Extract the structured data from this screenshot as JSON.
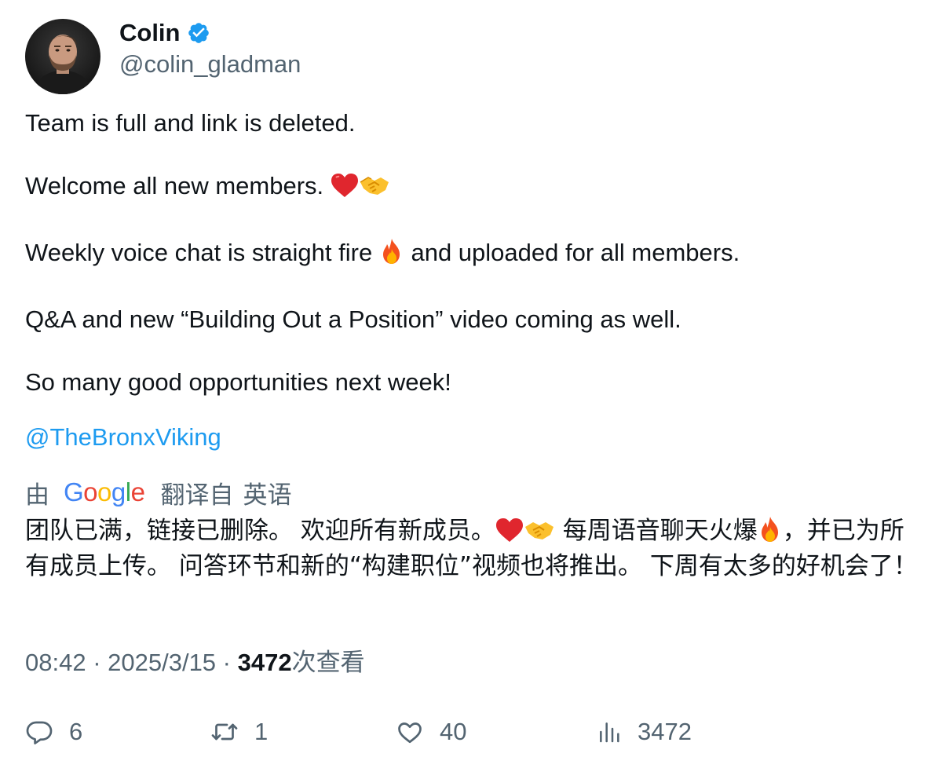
{
  "author": {
    "display_name": "Colin",
    "handle": "@colin_gladman",
    "verified": true,
    "avatar_icon": "avatar-photo"
  },
  "tweet": {
    "line1": "Team is full and link is deleted.",
    "line2_text": "Welcome all new members.",
    "line2_emoji": [
      "red-heart",
      "handshake"
    ],
    "line3_before": "Weekly voice chat is straight fire",
    "line3_emoji": "fire",
    "line3_after": "and uploaded for all members.",
    "line4": "Q&A and new “Building Out a Position” video coming as well.",
    "line5": "So many good opportunities next week!",
    "mention": "@TheBronxViking"
  },
  "translation": {
    "prefix": "由",
    "provider": "Google",
    "suffix": "翻译自",
    "language": "英语",
    "text_part1": "团队已满，链接已删除。 欢迎所有新成员。",
    "text_part2": " 每周语音聊天火爆",
    "text_part3": "，并已为所有成员上传。 问答环节和新的“构建职位”视频也将推出。 下周有太多的好机会了！"
  },
  "meta": {
    "time": "08:42",
    "separator": " · ",
    "date": "2025/3/15",
    "views_count": "3472",
    "views_label": "次查看"
  },
  "actions": {
    "replies": "6",
    "retweets": "1",
    "likes": "40",
    "views": "3472"
  },
  "colors": {
    "text": "#0f1419",
    "secondary": "#536471",
    "link": "#1d9bf0",
    "verified": "#1d9bf0"
  }
}
